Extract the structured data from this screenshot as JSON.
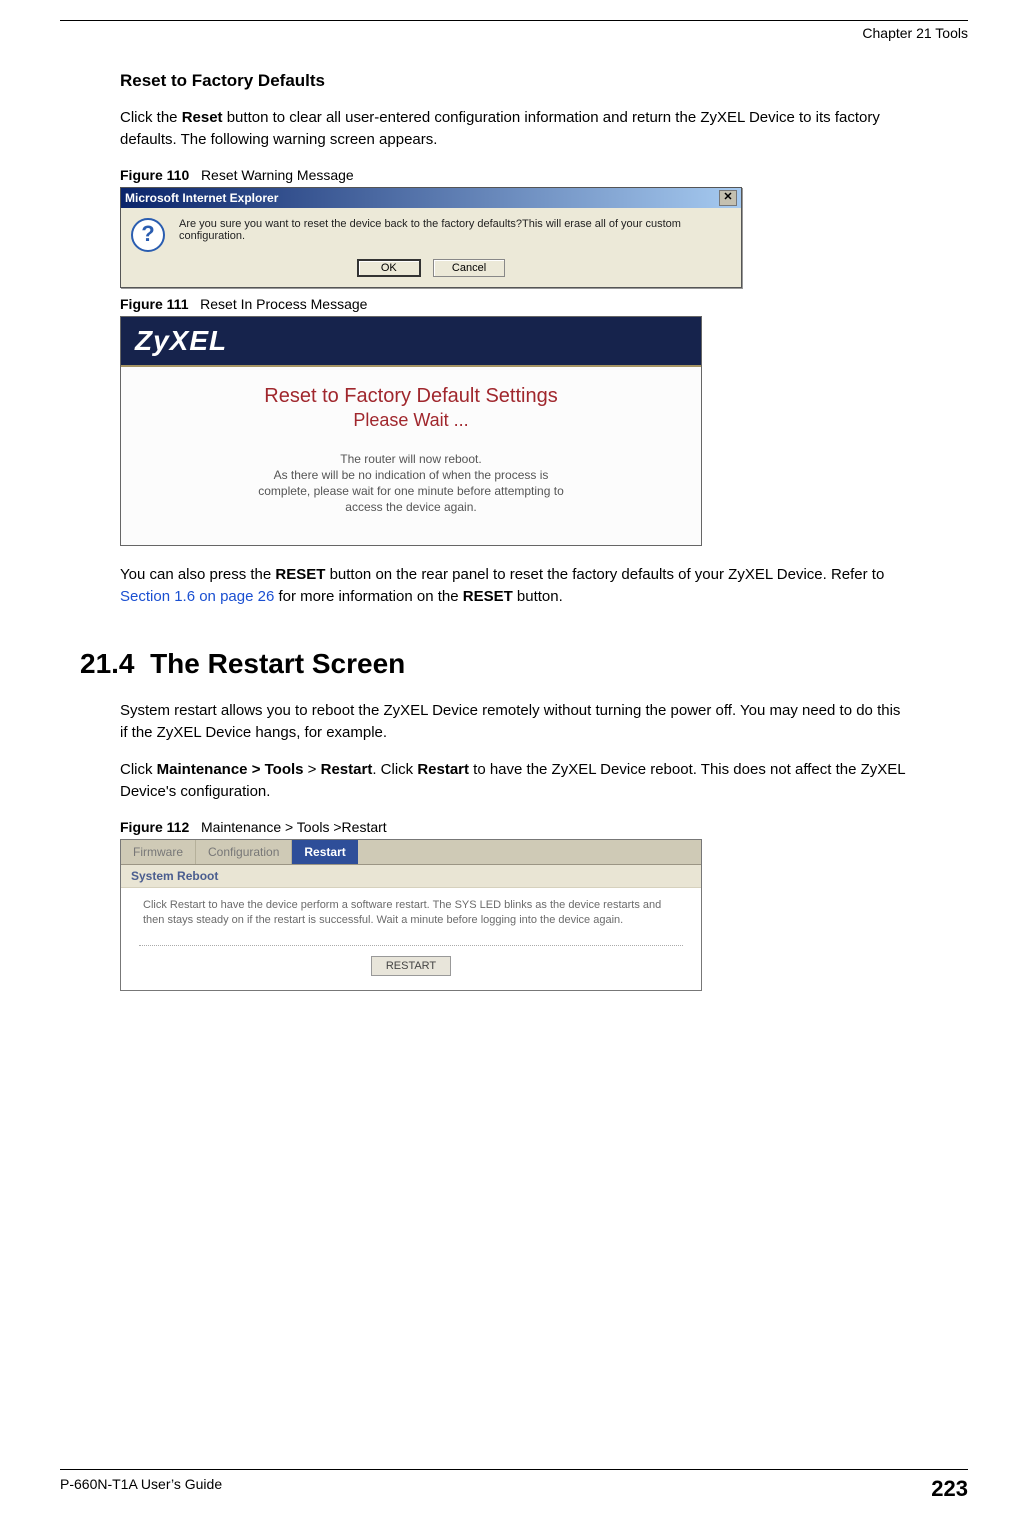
{
  "header": {
    "chapter": "Chapter 21 Tools"
  },
  "section_reset": {
    "title": "Reset to Factory Defaults",
    "para1_a": "Click the ",
    "para1_b": "Reset",
    "para1_c": " button to clear all user-entered configuration information and return the ZyXEL Device to its factory defaults. The following warning screen appears."
  },
  "figure110": {
    "label": "Figure 110",
    "caption": "Reset Warning Message",
    "dialog_title": "Microsoft Internet Explorer",
    "message": "Are you sure you want to reset the device back to the factory defaults?This will erase all of your custom configuration.",
    "ok": "OK",
    "cancel": "Cancel"
  },
  "figure111": {
    "label": "Figure 111",
    "caption": "Reset In Process Message",
    "logo": "ZyXEL",
    "line1": "Reset to Factory Default Settings",
    "line2": "Please Wait ...",
    "msg1": "The router will now reboot.",
    "msg2": "As there will be no indication of when the process is",
    "msg3": "complete, please wait for one minute before attempting to",
    "msg4": "access the device again."
  },
  "para_after_figs": {
    "a": "You can also press the ",
    "b": "RESET",
    "c": " button on the rear panel to reset the factory defaults of your ZyXEL Device. Refer to ",
    "link": "Section 1.6 on page 26",
    "d": " for more information on the ",
    "e": "RESET",
    "f": " button."
  },
  "section_restart": {
    "number": "21.4",
    "title": "The Restart Screen",
    "para1": "System restart allows you to reboot the ZyXEL Device remotely without turning the power off. You may need to do this if the ZyXEL Device hangs, for example.",
    "para2_a": "Click ",
    "para2_b": "Maintenance > Tools",
    "para2_c": " > ",
    "para2_d": "Restart",
    "para2_e": ". Click ",
    "para2_f": "Restart",
    "para2_g": " to have the ZyXEL Device reboot. This does not affect the ZyXEL Device's configuration."
  },
  "figure112": {
    "label": "Figure 112",
    "caption": "Maintenance > Tools >Restart",
    "tabs": [
      "Firmware",
      "Configuration",
      "Restart"
    ],
    "active_tab_index": 2,
    "section": "System Reboot",
    "body": "Click Restart to have the device perform a software restart. The SYS LED blinks as the device restarts and then stays steady on if the restart is successful. Wait a minute before logging into the device again.",
    "button": "RESTART"
  },
  "footer": {
    "guide": "P-660N-T1A User’s Guide",
    "page": "223"
  }
}
